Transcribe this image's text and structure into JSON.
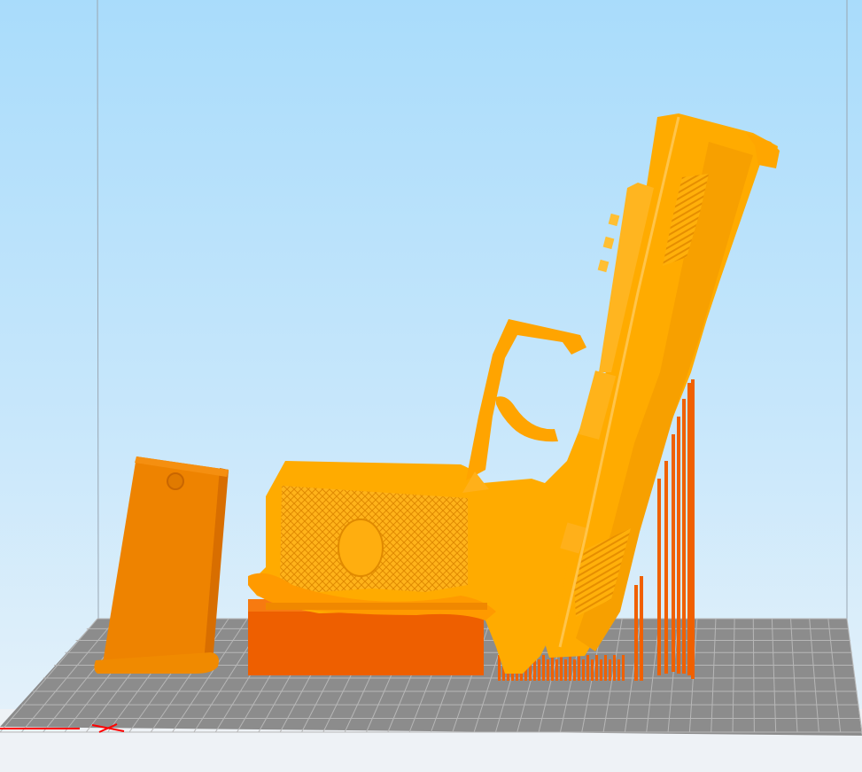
{
  "viewport": {
    "view": "front",
    "colors": {
      "sky_top": "#a9dcfb",
      "sky_bottom": "#e8f3fb",
      "ground": "#eef2f6",
      "build_plate": "#8c8c8c",
      "plate_grid": "#bcbcbc",
      "model": "#ffab00",
      "model_shade": "#f29300",
      "support": "#f06000",
      "support_dark": "#d94f00",
      "x_axis": "#ff0000"
    },
    "objects": [
      {
        "name": "pistol-frame-model",
        "supports": true
      },
      {
        "name": "magazine-model",
        "supports": false
      }
    ]
  }
}
